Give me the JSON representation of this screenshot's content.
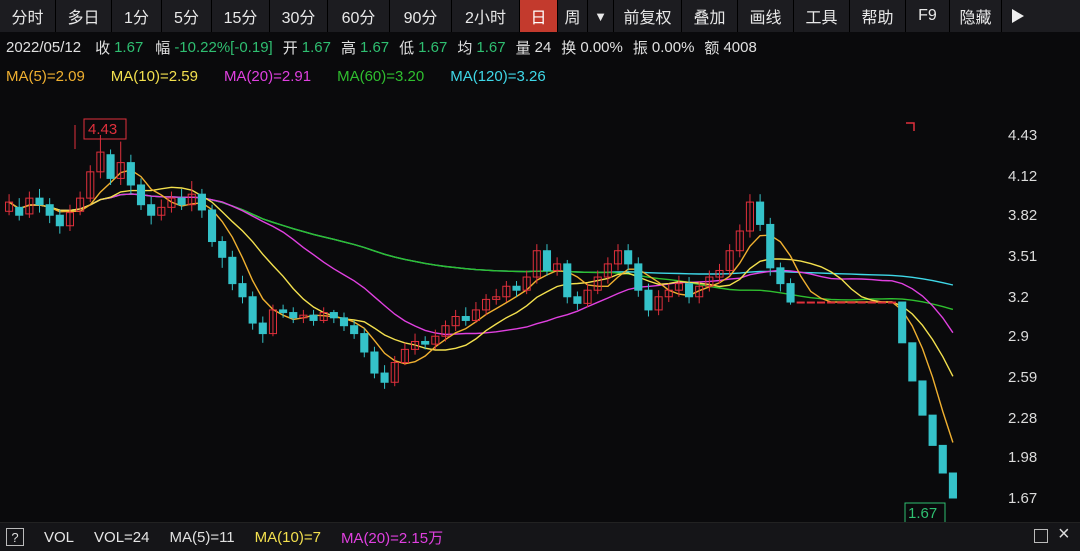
{
  "toolbar": {
    "items": [
      "分时",
      "多日",
      "1分",
      "5分",
      "15分",
      "30分",
      "60分",
      "90分",
      "2小时",
      "日",
      "周",
      "▼",
      "前复权",
      "叠加",
      "画线",
      "工具",
      "帮助",
      "F9",
      "隐藏"
    ],
    "active_index": 9,
    "play_icon": "play-icon"
  },
  "info": {
    "date": "2022/05/12",
    "close_label": "收",
    "close_value": "1.67",
    "range_label": "幅",
    "range_value": "-10.22%[-0.19]",
    "open_label": "开",
    "open_value": "1.67",
    "high_label": "高",
    "high_value": "1.67",
    "low_label": "低",
    "low_value": "1.67",
    "avg_label": "均",
    "avg_value": "1.67",
    "vol_label": "量",
    "vol_value": "24",
    "turnover_label": "换",
    "turnover_value": "0.00%",
    "amp_label": "振",
    "amp_value": "0.00%",
    "amount_label": "额",
    "amount_value": "4008"
  },
  "ma_legend": [
    {
      "text": "MA(5)=2.09",
      "color": "#f0b030"
    },
    {
      "text": "MA(10)=2.59",
      "color": "#f3e04e"
    },
    {
      "text": "MA(20)=2.91",
      "color": "#e040e0"
    },
    {
      "text": "MA(60)=3.20",
      "color": "#2fbf2f"
    },
    {
      "text": "MA(120)=3.26",
      "color": "#3fd8e8"
    }
  ],
  "bottom": {
    "question_icon": "question-icon",
    "vol_label": "VOL",
    "vol_value": "VOL=24",
    "ma5": "MA(5)=11",
    "ma10": "MA(10)=7",
    "ma20": "MA(20)=2.15万",
    "ma5_color": "#e0e0e0",
    "ma10_color": "#f3e04e",
    "ma20_color": "#e040e0"
  },
  "chart_data": {
    "type": "candlestick",
    "y_ticks": [
      "4.43",
      "4.12",
      "3.82",
      "3.51",
      "3.2",
      "2.9",
      "2.59",
      "2.28",
      "1.98",
      "1.67"
    ],
    "ylim": [
      1.67,
      4.43
    ],
    "max_label": "4.43",
    "last_label": "1.67",
    "up_color": "#e0303c",
    "down_color": "#35c2c9",
    "candles": [
      [
        3.85,
        3.92,
        3.98,
        3.82
      ],
      [
        3.88,
        3.82,
        3.95,
        3.78
      ],
      [
        3.83,
        3.95,
        4.0,
        3.8
      ],
      [
        3.95,
        3.9,
        4.02,
        3.84
      ],
      [
        3.9,
        3.82,
        3.95,
        3.76
      ],
      [
        3.82,
        3.74,
        3.86,
        3.68
      ],
      [
        3.74,
        3.84,
        3.9,
        3.7
      ],
      [
        3.85,
        3.95,
        4.0,
        3.82
      ],
      [
        3.95,
        4.15,
        4.2,
        3.92
      ],
      [
        4.15,
        4.3,
        4.43,
        4.1
      ],
      [
        4.28,
        4.1,
        4.32,
        4.05
      ],
      [
        4.1,
        4.22,
        4.38,
        4.05
      ],
      [
        4.22,
        4.05,
        4.28,
        3.98
      ],
      [
        4.05,
        3.9,
        4.1,
        3.86
      ],
      [
        3.9,
        3.82,
        3.96,
        3.75
      ],
      [
        3.82,
        3.88,
        3.94,
        3.78
      ],
      [
        3.88,
        3.95,
        4.0,
        3.84
      ],
      [
        3.95,
        3.9,
        4.02,
        3.86
      ],
      [
        3.9,
        3.98,
        4.08,
        3.85
      ],
      [
        3.98,
        3.86,
        4.02,
        3.8
      ],
      [
        3.86,
        3.62,
        3.9,
        3.58
      ],
      [
        3.62,
        3.5,
        3.66,
        3.42
      ],
      [
        3.5,
        3.3,
        3.55,
        3.25
      ],
      [
        3.3,
        3.2,
        3.36,
        3.15
      ],
      [
        3.2,
        3.0,
        3.24,
        2.95
      ],
      [
        3.0,
        2.92,
        3.05,
        2.85
      ],
      [
        2.92,
        3.1,
        3.14,
        2.9
      ],
      [
        3.1,
        3.08,
        3.14,
        3.04
      ],
      [
        3.08,
        3.04,
        3.12,
        3.0
      ],
      [
        3.04,
        3.06,
        3.1,
        3.0
      ],
      [
        3.06,
        3.02,
        3.1,
        2.98
      ],
      [
        3.02,
        3.08,
        3.12,
        3.0
      ],
      [
        3.08,
        3.04,
        3.1,
        3.0
      ],
      [
        3.04,
        2.98,
        3.08,
        2.94
      ],
      [
        2.98,
        2.92,
        3.02,
        2.88
      ],
      [
        2.92,
        2.78,
        2.96,
        2.74
      ],
      [
        2.78,
        2.62,
        2.82,
        2.58
      ],
      [
        2.62,
        2.55,
        2.68,
        2.5
      ],
      [
        2.55,
        2.7,
        2.75,
        2.52
      ],
      [
        2.7,
        2.8,
        2.85,
        2.68
      ],
      [
        2.8,
        2.86,
        2.92,
        2.76
      ],
      [
        2.86,
        2.84,
        2.9,
        2.8
      ],
      [
        2.84,
        2.9,
        2.95,
        2.8
      ],
      [
        2.9,
        2.98,
        3.02,
        2.86
      ],
      [
        2.98,
        3.05,
        3.1,
        2.94
      ],
      [
        3.05,
        3.02,
        3.12,
        2.98
      ],
      [
        3.02,
        3.1,
        3.16,
        3.0
      ],
      [
        3.1,
        3.18,
        3.22,
        3.06
      ],
      [
        3.18,
        3.2,
        3.26,
        3.14
      ],
      [
        3.2,
        3.28,
        3.32,
        3.16
      ],
      [
        3.28,
        3.25,
        3.32,
        3.2
      ],
      [
        3.25,
        3.35,
        3.4,
        3.22
      ],
      [
        3.35,
        3.55,
        3.6,
        3.3
      ],
      [
        3.55,
        3.4,
        3.6,
        3.36
      ],
      [
        3.4,
        3.45,
        3.5,
        3.36
      ],
      [
        3.45,
        3.2,
        3.48,
        3.15
      ],
      [
        3.2,
        3.15,
        3.24,
        3.1
      ],
      [
        3.15,
        3.25,
        3.3,
        3.12
      ],
      [
        3.25,
        3.35,
        3.4,
        3.22
      ],
      [
        3.35,
        3.45,
        3.5,
        3.3
      ],
      [
        3.45,
        3.55,
        3.6,
        3.4
      ],
      [
        3.55,
        3.45,
        3.6,
        3.4
      ],
      [
        3.45,
        3.25,
        3.5,
        3.2
      ],
      [
        3.25,
        3.1,
        3.3,
        3.05
      ],
      [
        3.1,
        3.2,
        3.25,
        3.06
      ],
      [
        3.2,
        3.25,
        3.3,
        3.16
      ],
      [
        3.25,
        3.3,
        3.36,
        3.2
      ],
      [
        3.3,
        3.2,
        3.35,
        3.15
      ],
      [
        3.2,
        3.28,
        3.32,
        3.15
      ],
      [
        3.28,
        3.35,
        3.4,
        3.24
      ],
      [
        3.35,
        3.4,
        3.45,
        3.3
      ],
      [
        3.4,
        3.55,
        3.6,
        3.36
      ],
      [
        3.55,
        3.7,
        3.75,
        3.5
      ],
      [
        3.7,
        3.92,
        3.98,
        3.65
      ],
      [
        3.92,
        3.75,
        3.98,
        3.7
      ],
      [
        3.75,
        3.42,
        3.8,
        3.36
      ],
      [
        3.42,
        3.3,
        3.46,
        3.24
      ],
      [
        3.3,
        3.16,
        3.34,
        3.14
      ],
      [
        3.16,
        3.16,
        3.16,
        3.16
      ],
      [
        3.16,
        3.16,
        3.16,
        3.16
      ],
      [
        3.16,
        3.16,
        3.16,
        3.16
      ],
      [
        3.16,
        3.16,
        3.16,
        3.16
      ],
      [
        3.16,
        3.16,
        3.16,
        3.16
      ],
      [
        3.16,
        3.16,
        3.16,
        3.16
      ],
      [
        3.16,
        3.16,
        3.16,
        3.16
      ],
      [
        3.16,
        3.16,
        3.16,
        3.16
      ],
      [
        3.16,
        3.16,
        3.16,
        3.16
      ],
      [
        3.16,
        3.16,
        3.16,
        3.16
      ],
      [
        3.16,
        2.85,
        3.16,
        2.85
      ],
      [
        2.85,
        2.56,
        2.85,
        2.56
      ],
      [
        2.56,
        2.3,
        2.56,
        2.3
      ],
      [
        2.3,
        2.07,
        2.3,
        2.07
      ],
      [
        2.07,
        1.86,
        2.07,
        1.86
      ],
      [
        1.86,
        1.67,
        1.86,
        1.67
      ]
    ]
  }
}
